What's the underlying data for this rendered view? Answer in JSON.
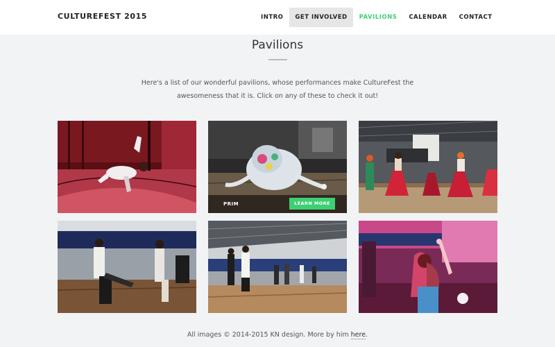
{
  "brand": "CULTUREFEST 2015",
  "nav": {
    "intro": "INTRO",
    "get_involved": "GET INVOLVED",
    "pavilions": "PAVILIONS",
    "calendar": "CALENDAR",
    "contact": "CONTACT"
  },
  "main": {
    "title": "Pavilions",
    "intro_line1": "Here's a list of our wonderful pavilions, whose performances make CultureFest the",
    "intro_line2": "awesomeness that it is. Click on any of these to check it out!"
  },
  "tiles": {
    "hovered": {
      "label": "PRIM",
      "button": "LEARN MORE"
    }
  },
  "footer": {
    "text": "All images © 2014-2015 KN design. More by him",
    "link": "here",
    "end": "."
  },
  "colors": {
    "accent": "#3ecf73",
    "nav_hover_bg": "#e6e6e6",
    "page_bg": "#f2f3f5"
  }
}
